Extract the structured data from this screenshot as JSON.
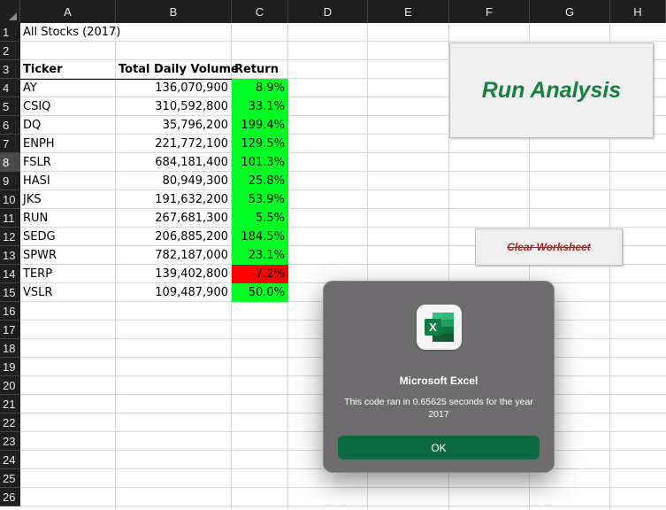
{
  "columns": [
    "A",
    "B",
    "C",
    "D",
    "E",
    "F",
    "G",
    "H"
  ],
  "rows": [
    "1",
    "2",
    "3",
    "4",
    "5",
    "6",
    "7",
    "8",
    "9",
    "10",
    "11",
    "12",
    "13",
    "14",
    "15",
    "16",
    "17",
    "18",
    "19",
    "20",
    "21",
    "22",
    "23",
    "24",
    "25",
    "26"
  ],
  "selected_row": "8",
  "title_cell": "All Stocks (2017)",
  "headers": {
    "ticker": "Ticker",
    "volume": "Total Daily Volume",
    "return": "Return"
  },
  "stocks": [
    {
      "ticker": "AY",
      "volume": "136,070,900",
      "ret": "8.9%",
      "positive": true
    },
    {
      "ticker": "CSIQ",
      "volume": "310,592,800",
      "ret": "33.1%",
      "positive": true
    },
    {
      "ticker": "DQ",
      "volume": "35,796,200",
      "ret": "199.4%",
      "positive": true
    },
    {
      "ticker": "ENPH",
      "volume": "221,772,100",
      "ret": "129.5%",
      "positive": true
    },
    {
      "ticker": "FSLR",
      "volume": "684,181,400",
      "ret": "101.3%",
      "positive": true
    },
    {
      "ticker": "HASI",
      "volume": "80,949,300",
      "ret": "25.8%",
      "positive": true
    },
    {
      "ticker": "JKS",
      "volume": "191,632,200",
      "ret": "53.9%",
      "positive": true
    },
    {
      "ticker": "RUN",
      "volume": "267,681,300",
      "ret": "5.5%",
      "positive": true
    },
    {
      "ticker": "SEDG",
      "volume": "206,885,200",
      "ret": "184.5%",
      "positive": true
    },
    {
      "ticker": "SPWR",
      "volume": "782,187,000",
      "ret": "23.1%",
      "positive": true
    },
    {
      "ticker": "TERP",
      "volume": "139,402,800",
      "ret": "-7.2%",
      "positive": false
    },
    {
      "ticker": "VSLR",
      "volume": "109,487,900",
      "ret": "50.0%",
      "positive": true
    }
  ],
  "buttons": {
    "run": "Run Analysis",
    "clear": "Clear Worksheet"
  },
  "dialog": {
    "title": "Microsoft Excel",
    "message": "This code ran in 0.65625 seconds for the year 2017",
    "ok": "OK",
    "icon": "excel-app-icon"
  },
  "colors": {
    "positive": "#00ff23",
    "negative": "#ff0000",
    "run_text": "#16803d",
    "clear_text": "#b01c1c",
    "ok_button": "#0d6a3e"
  }
}
